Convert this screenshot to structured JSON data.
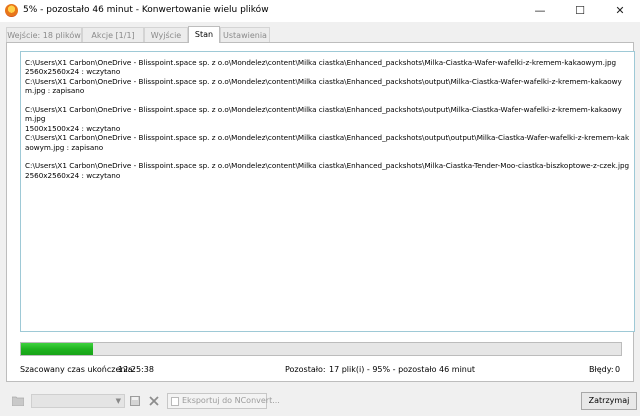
{
  "window": {
    "title": "5% - pozostało 46 minut - Konwertowanie wielu plików",
    "minimize_glyph": "—",
    "maximize_glyph": "☐",
    "close_glyph": "✕"
  },
  "tabs": [
    {
      "label": "Wejście: 18 plików",
      "active": false
    },
    {
      "label": "Akcje [1/1]",
      "active": false
    },
    {
      "label": "Wyjście",
      "active": false
    },
    {
      "label": "Stan",
      "active": true
    },
    {
      "label": "Ustawienia",
      "active": false
    }
  ],
  "log": {
    "lines": [
      "C:\\Users\\X1 Carbon\\OneDrive - Blisspoint.space sp. z o.o\\Mondelez\\content\\Milka ciastka\\Enhanced_packshots\\Milka-Ciastka-Wafer-wafelki-z-kremem-kakaowym.jpg",
      "2560x2560x24 : wczytano",
      "C:\\Users\\X1 Carbon\\OneDrive - Blisspoint.space sp. z o.o\\Mondelez\\content\\Milka ciastka\\Enhanced_packshots\\output\\Milka-Ciastka-Wafer-wafelki-z-kremem-kakaowym.jpg : zapisano",
      "",
      "C:\\Users\\X1 Carbon\\OneDrive - Blisspoint.space sp. z o.o\\Mondelez\\content\\Milka ciastka\\Enhanced_packshots\\output\\Milka-Ciastka-Wafer-wafelki-z-kremem-kakaowym.jpg",
      "1500x1500x24 : wczytano",
      "C:\\Users\\X1 Carbon\\OneDrive - Blisspoint.space sp. z o.o\\Mondelez\\content\\Milka ciastka\\Enhanced_packshots\\output\\output\\Milka-Ciastka-Wafer-wafelki-z-kremem-kakaowym.jpg : zapisano",
      "",
      "C:\\Users\\X1 Carbon\\OneDrive - Blisspoint.space sp. z o.o\\Mondelez\\content\\Milka ciastka\\Enhanced_packshots\\Milka-Ciastka-Tender-Moo-ciastka-biszkoptowe-z-czek.jpg",
      "2560x2560x24 : wczytano"
    ]
  },
  "progress": {
    "percent": 12,
    "color": "#22b822"
  },
  "status": {
    "estimated_label": "Szacowany czas ukończenia:",
    "estimated_value": "12:25:38",
    "remaining_label": "Pozostało:",
    "remaining_value": "17 plik(i) - 95% - pozostało 46 minut",
    "errors_label": "Błędy:",
    "errors_value": "0"
  },
  "bottombar": {
    "export_label": "Eksportuj do NConvert...",
    "stop_label": "Zatrzymaj"
  },
  "icons": {
    "app": "xnconvert-app-icon",
    "folder": "folder-icon",
    "save": "save-icon",
    "delete": "delete-icon",
    "export": "document-icon"
  }
}
